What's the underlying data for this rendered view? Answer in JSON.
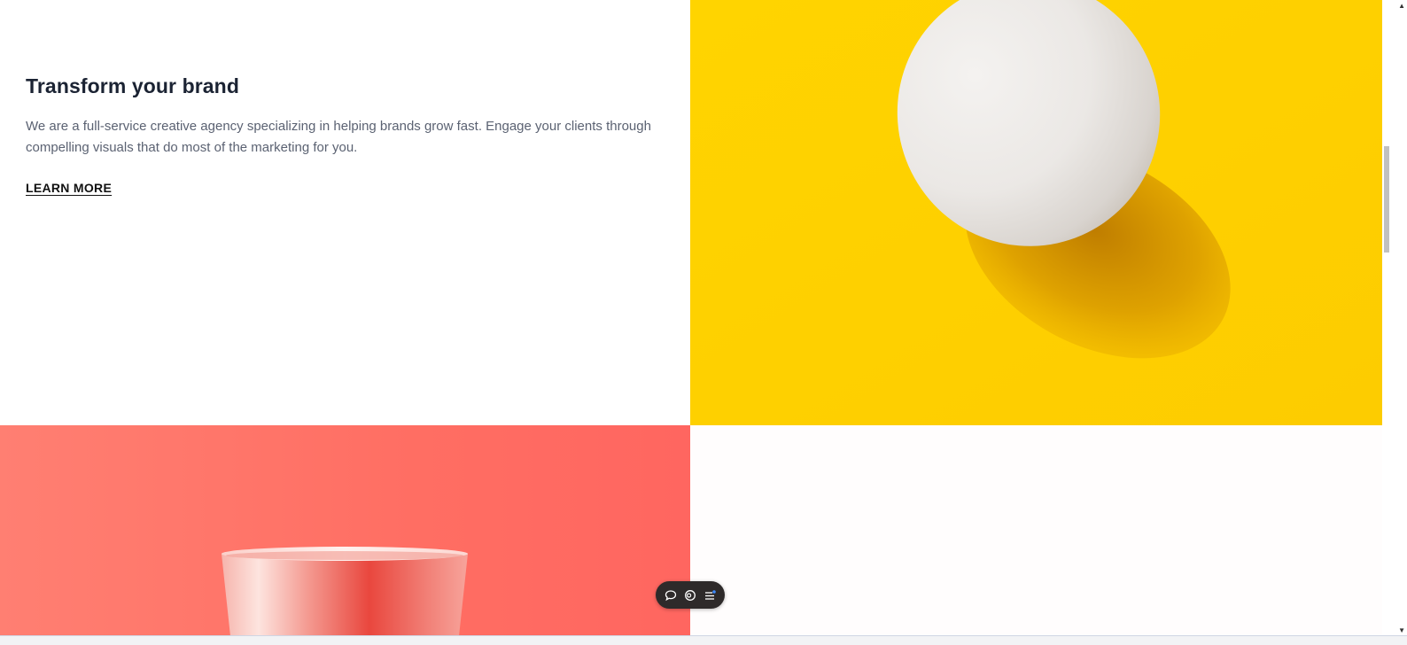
{
  "section": {
    "headline": "Transform your brand",
    "body": "We are a full-service creative agency specializing in helping brands grow fast. Engage your clients through compelling visuals that do most of the marketing for you.",
    "cta_label": "LEARN MORE"
  },
  "colors": {
    "egg_background": "#fed001",
    "cup_background": "#ff6e63",
    "headline": "#1b2333",
    "body_text": "#5b6272"
  },
  "toolbar": {
    "icons": [
      "chat-icon",
      "toggle-icon",
      "menu-icon"
    ]
  }
}
